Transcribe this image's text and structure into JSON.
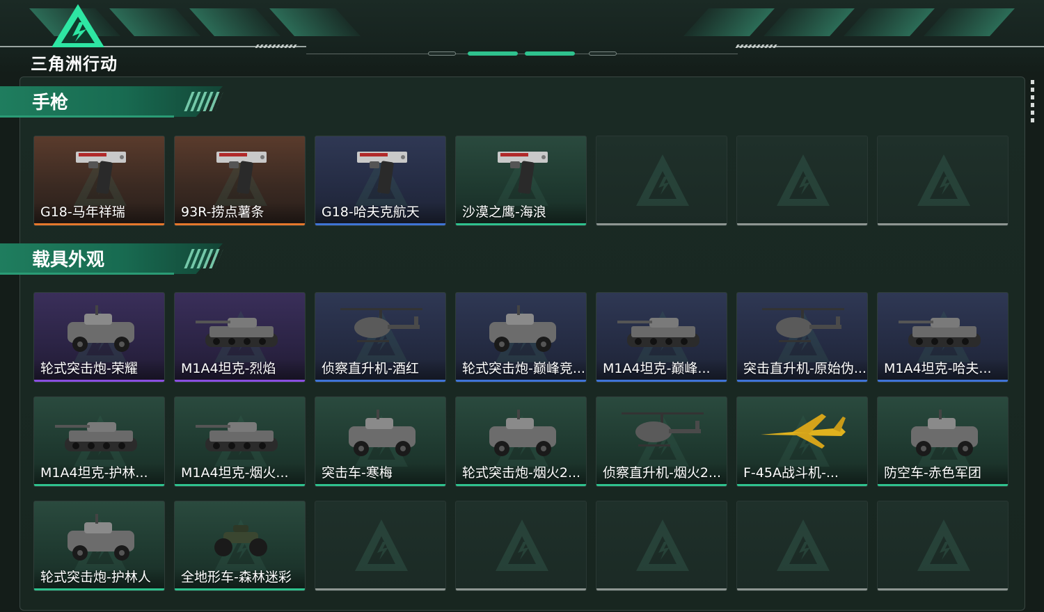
{
  "app": {
    "logo_text": "三角洲行动",
    "logo_icon": "delta-triangle-icon"
  },
  "colors": {
    "accent": "#2fc28e",
    "rarity_orange": "#e6782c",
    "rarity_blue": "#3f74d6",
    "rarity_purple": "#8a4fe0",
    "rarity_green": "#2fc28e",
    "rarity_empty": "#8e9692"
  },
  "sections": [
    {
      "title": "手枪",
      "items": [
        {
          "name": "G18-马年祥瑞",
          "rarity": "orange",
          "icon": "pistol-icon"
        },
        {
          "name": "93R-捞点薯条",
          "rarity": "orange",
          "icon": "pistol-icon"
        },
        {
          "name": "G18-哈夫克航天",
          "rarity": "blue",
          "icon": "pistol-icon"
        },
        {
          "name": "沙漠之鹰-海浪",
          "rarity": "green",
          "icon": "pistol-icon"
        },
        {
          "name": "",
          "rarity": "empty"
        },
        {
          "name": "",
          "rarity": "empty"
        },
        {
          "name": "",
          "rarity": "empty"
        }
      ]
    },
    {
      "title": "载具外观",
      "items": [
        {
          "name": "轮式突击炮-荣耀",
          "rarity": "purple",
          "icon": "armored-car-icon"
        },
        {
          "name": "M1A4坦克-烈焰",
          "rarity": "purple",
          "icon": "tank-icon"
        },
        {
          "name": "侦察直升机-酒红",
          "rarity": "blue",
          "icon": "helicopter-icon"
        },
        {
          "name": "轮式突击炮-巅峰竞...",
          "rarity": "blue",
          "icon": "armored-car-icon"
        },
        {
          "name": "M1A4坦克-巅峰...",
          "rarity": "blue",
          "icon": "tank-icon"
        },
        {
          "name": "突击直升机-原始伪...",
          "rarity": "blue",
          "icon": "helicopter-icon"
        },
        {
          "name": "M1A4坦克-哈夫...",
          "rarity": "blue",
          "icon": "tank-icon"
        },
        {
          "name": "M1A4坦克-护林...",
          "rarity": "green",
          "icon": "tank-icon"
        },
        {
          "name": "M1A4坦克-烟火...",
          "rarity": "green",
          "icon": "tank-icon"
        },
        {
          "name": "突击车-寒梅",
          "rarity": "green",
          "icon": "armored-car-icon"
        },
        {
          "name": "轮式突击炮-烟火2...",
          "rarity": "green",
          "icon": "armored-car-icon"
        },
        {
          "name": "侦察直升机-烟火2...",
          "rarity": "green",
          "icon": "helicopter-icon"
        },
        {
          "name": "F-45A战斗机-...",
          "rarity": "green",
          "icon": "jet-icon"
        },
        {
          "name": "防空车-赤色军团",
          "rarity": "green",
          "icon": "armored-car-icon"
        },
        {
          "name": "轮式突击炮-护林人",
          "rarity": "green",
          "icon": "armored-car-icon"
        },
        {
          "name": "全地形车-森林迷彩",
          "rarity": "green",
          "icon": "atv-icon"
        },
        {
          "name": "",
          "rarity": "empty"
        },
        {
          "name": "",
          "rarity": "empty"
        },
        {
          "name": "",
          "rarity": "empty"
        },
        {
          "name": "",
          "rarity": "empty"
        },
        {
          "name": "",
          "rarity": "empty"
        }
      ]
    }
  ]
}
